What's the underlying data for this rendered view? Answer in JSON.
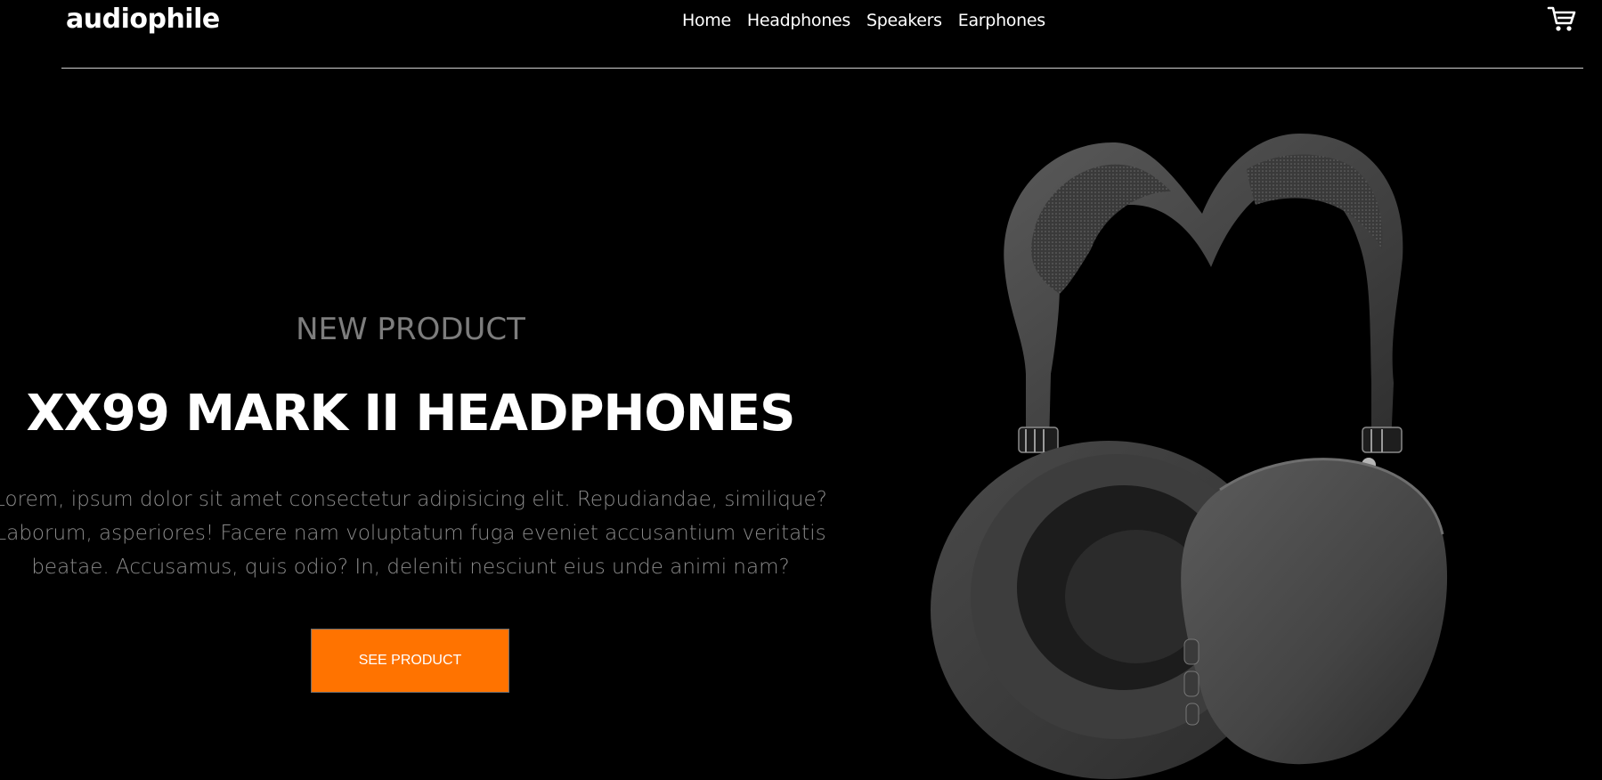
{
  "brand": {
    "name": "audiophile"
  },
  "nav": {
    "items": [
      {
        "label": "Home"
      },
      {
        "label": "Headphones"
      },
      {
        "label": "Speakers"
      },
      {
        "label": "Earphones"
      }
    ]
  },
  "header": {
    "cart_icon": "shopping-cart-icon"
  },
  "hero": {
    "eyebrow": "NEW PRODUCT",
    "title": "XX99 MARK II HEADPHONES",
    "description": "Lorem, ipsum dolor sit amet consectetur adipisicing elit. Repudiandae, similique? Laborum, asperiores! Facere nam voluptatum fuga eveniet accusantium veritatis beatae. Accusamus, quis odio? In, deleniti nesciunt eius unde animi nam?",
    "cta_label": "SEE PRODUCT",
    "product_image_icon": "headphones-image"
  },
  "colors": {
    "background": "#000000",
    "accent": "#ff7300",
    "muted_text": "#7d7d7d"
  }
}
